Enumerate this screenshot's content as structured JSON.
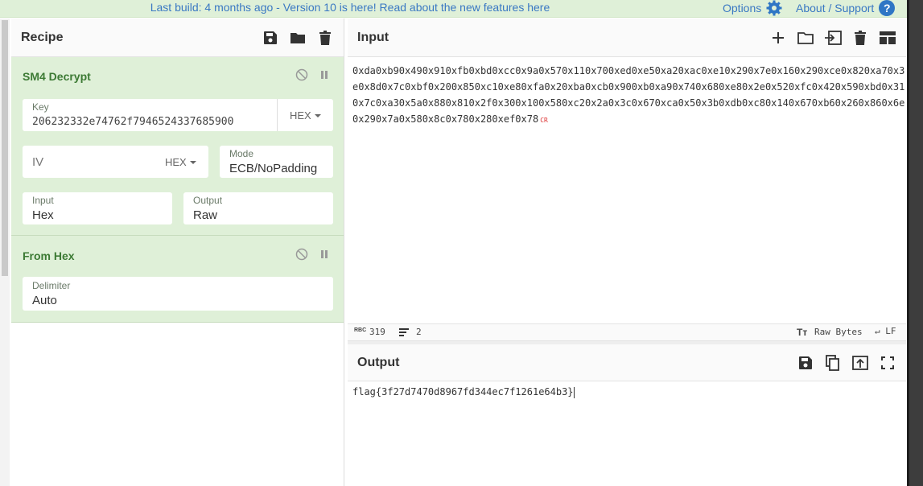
{
  "banner": {
    "message": "Last build: 4 months ago - Version 10 is here! Read about the new features here",
    "options_label": "Options",
    "about_label": "About / Support"
  },
  "recipe": {
    "title": "Recipe",
    "operations": [
      {
        "title": "SM4 Decrypt",
        "key_label": "Key",
        "key_value": "206232332e74762f7946524337685900",
        "key_format": "HEX",
        "iv_placeholder": "IV",
        "iv_format": "HEX",
        "mode_label": "Mode",
        "mode_value": "ECB/NoPadding",
        "input_label": "Input",
        "input_value": "Hex",
        "output_label": "Output",
        "output_value": "Raw"
      },
      {
        "title": "From Hex",
        "delimiter_label": "Delimiter",
        "delimiter_value": "Auto"
      }
    ]
  },
  "input": {
    "title": "Input",
    "text": "0xda0xb90x490x910xfb0xbd0xcc0x9a0x570x110x700xed0xe50xa20xac0xe10x290x7e0x160x290xce0x820xa70x3e0x8d0x7c0xbf0x200x850xc10xe80xfa0x20xba0xcb0x900xb0xa90x740x680xe80x2e0x520xfc0x420x590xbd0x310x7c0xa30x5a0x880x810x2f0x300x100x580xc20x2a0x3c0x670xca0x50x3b0xdb0xc80x140x670xb60x260x860x6e0x290x7a0x580x8c0x780x280xef0x78",
    "cr_marker": "CR"
  },
  "status": {
    "rbc_label": "RBC",
    "char_count": "319",
    "line_count": "2",
    "encoding": "Raw Bytes",
    "eol": "LF"
  },
  "output": {
    "title": "Output",
    "text": "flag{3f27d7470d8967fd344ec7f1261e64b3}"
  },
  "colors": {
    "banner_bg": "#dff0d8",
    "op_bg": "#dff0d8",
    "op_title": "#3c7a34",
    "link": "#3a78c3"
  }
}
